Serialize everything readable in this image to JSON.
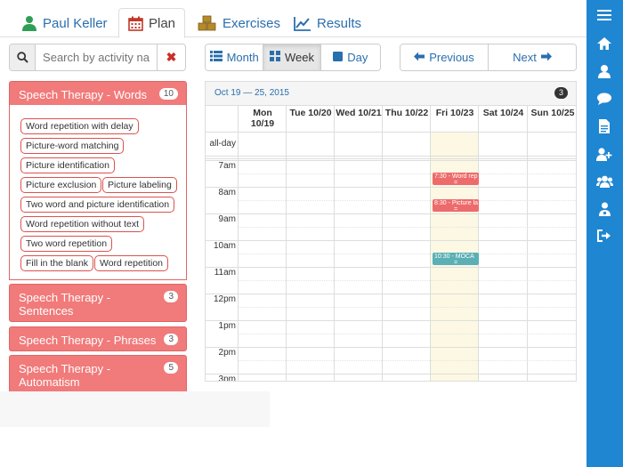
{
  "tabs": [
    {
      "label": "Paul Keller",
      "icon": "user-icon"
    },
    {
      "label": "Plan",
      "icon": "calendar-icon"
    },
    {
      "label": "Exercises",
      "icon": "cubes-icon"
    },
    {
      "label": "Results",
      "icon": "line-chart-icon"
    }
  ],
  "search": {
    "placeholder": "Search by activity na"
  },
  "categories": [
    {
      "title": "Speech Therapy - Words",
      "count": "10",
      "items": [
        "Word repetition with delay",
        "Picture-word matching",
        "Picture identification",
        "Picture exclusion",
        "Picture labeling",
        "Two word and picture identification",
        "Word repetition without text",
        "Two word repetition",
        "Fill in the blank",
        "Word repetition"
      ]
    },
    {
      "title": "Speech Therapy - Sentences",
      "title_lines": [
        "Speech Therapy -",
        "Sentences"
      ],
      "count": "3"
    },
    {
      "title": "Speech Therapy - Phrases",
      "count": "3"
    },
    {
      "title": "Speech Therapy - Automatism",
      "title_lines": [
        "Speech Therapy -",
        "Automatism"
      ],
      "count": "5"
    }
  ],
  "views": {
    "month": "Month",
    "week": "Week",
    "day": "Day",
    "active": "Week"
  },
  "nav": {
    "previous": "Previous",
    "next": "Next"
  },
  "calendar": {
    "range": "Oct 19 — 25, 2015",
    "event_count": "3",
    "days": [
      {
        "line1": "Mon",
        "line2": "10/19"
      },
      {
        "line1": "Tue 10/20",
        "line2": ""
      },
      {
        "line1": "Wed 10/21",
        "line2": ""
      },
      {
        "line1": "Thu 10/22",
        "line2": ""
      },
      {
        "line1": "Fri 10/23",
        "line2": ""
      },
      {
        "line1": "Sat 10/24",
        "line2": ""
      },
      {
        "line1": "Sun 10/25",
        "line2": ""
      }
    ],
    "today": "Fri 10/23",
    "allday_label": "all-day",
    "times": [
      "7am",
      "8am",
      "9am",
      "10am",
      "11am",
      "12pm",
      "1pm",
      "2pm",
      "3pm"
    ],
    "events": [
      {
        "text": "7:30 - Word rep",
        "day": "Fri 10/23",
        "start": "7:30",
        "color": "#ee6b6b"
      },
      {
        "text": "8:30 - Picture la",
        "day": "Fri 10/23",
        "start": "8:30",
        "color": "#ee6b6b"
      },
      {
        "text": "10:30 - MOCA",
        "day": "Fri 10/23",
        "start": "10:30",
        "color": "#5ab0b5"
      }
    ]
  },
  "sidebar_icons": [
    "menu-icon",
    "home-icon",
    "user-icon",
    "chat-icon",
    "document-icon",
    "add-user-icon",
    "group-icon",
    "user-key-icon",
    "logout-icon"
  ]
}
